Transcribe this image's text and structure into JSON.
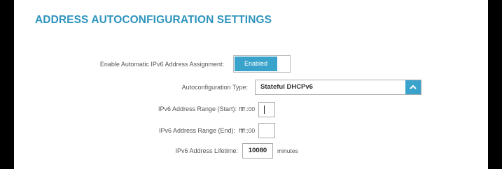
{
  "section": {
    "title": "ADDRESS AUTOCONFIGURATION SETTINGS"
  },
  "fields": {
    "enable_assignment": {
      "label": "Enable Automatic IPv6 Address Assignment:",
      "value": "Enabled"
    },
    "autoconfig_type": {
      "label": "Autoconfiguration Type:",
      "value": "Stateful DHCPv6"
    },
    "range_start": {
      "label": "IPv6 Address Range (Start):",
      "prefix": "ffff::00",
      "value": ""
    },
    "range_end": {
      "label": "IPv6 Address Range (End):",
      "prefix": "ffff::00",
      "value": ""
    },
    "lifetime": {
      "label": "IPv6 Address Lifetime:",
      "value": "10080",
      "unit": "minutes"
    }
  },
  "colors": {
    "accent": "#3aa3cc",
    "title": "#2e94bd"
  },
  "icons": {
    "select_toggle": "chevron-up-icon"
  }
}
